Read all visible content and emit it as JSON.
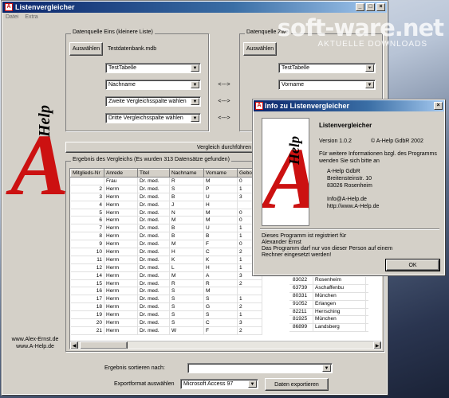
{
  "main_window": {
    "title": "Listenvergleicher",
    "menu": [
      "Datei",
      "Extra"
    ],
    "group1": {
      "label": "Datenquelle Eins (kleinere Liste)",
      "choose_button": "Auswählen",
      "file_value": "Testdatenbank.mdb",
      "table_value": "TestTabelle",
      "col1_value": "Nachname",
      "col2_value": "Zweite Vergleichsspalte wählen",
      "col3_value": "Dritte Vergleichsspalte wählen"
    },
    "arrows": [
      "<--->",
      "<--->",
      "<--->",
      "<--->"
    ],
    "group2": {
      "label": "Datenquelle Zwei",
      "choose_button": "Auswählen",
      "table_value": "TestTabelle",
      "col1_value": "Vorname"
    },
    "compare_button": "Vergleich durchführen",
    "results_label": "Ergebnis des Vergleichs (Es wurden 313 Datensätze gefunden)",
    "logo": {
      "letter": "A",
      "word": "Help"
    },
    "left_footer": [
      "www.Alex-Ernst.de",
      "www.A-Help.de"
    ],
    "sort_label": "Ergebnis sortieren nach:",
    "sort_value": "",
    "export_label": "Exportformat auswählen",
    "export_format": "Microsoft Access 97",
    "export_button": "Daten exportieren"
  },
  "table": {
    "columns": [
      "Mitglieds-Nr",
      "Anrede",
      "Titel",
      "Nachname",
      "Vorname",
      "Gebor"
    ],
    "rows": [
      [
        "",
        "Frau",
        "Dr. med.",
        "R",
        "M",
        "0"
      ],
      [
        "2",
        "Herrn",
        "Dr. med.",
        "S",
        "P",
        "1"
      ],
      [
        "3",
        "Herrn",
        "Dr. med.",
        "B",
        "U",
        "3"
      ],
      [
        "4",
        "Herrn",
        "Dr. med.",
        "J",
        "H",
        ""
      ],
      [
        "5",
        "Herrn",
        "Dr. med.",
        "N",
        "M",
        "0"
      ],
      [
        "6",
        "Herrn",
        "Dr. med.",
        "M",
        "M",
        "0"
      ],
      [
        "7",
        "Herrn",
        "Dr. med.",
        "B",
        "U",
        "1"
      ],
      [
        "8",
        "Herrn",
        "Dr. med.",
        "B",
        "B",
        "1"
      ],
      [
        "9",
        "Herrn",
        "Dr. med.",
        "M",
        "F",
        "0"
      ],
      [
        "10",
        "Herrn",
        "Dr. med.",
        "H",
        "C",
        "2"
      ],
      [
        "11",
        "Herrn",
        "Dr. med.",
        "K",
        "K",
        "1"
      ],
      [
        "12",
        "Herrn",
        "Dr. med.",
        "L",
        "H",
        "1"
      ],
      [
        "14",
        "Herrn",
        "Dr. med.",
        "M",
        "A",
        "3"
      ],
      [
        "15",
        "Herrn",
        "Dr. med.",
        "R",
        "R",
        "2"
      ],
      [
        "16",
        "Herrn",
        "Dr. med.",
        "S",
        "M",
        ""
      ],
      [
        "17",
        "Herrn",
        "Dr. med.",
        "S",
        "S",
        "1"
      ],
      [
        "18",
        "Herrn",
        "Dr. med.",
        "S",
        "G",
        "2"
      ],
      [
        "19",
        "Herrn",
        "Dr. med.",
        "S",
        "S",
        "1"
      ],
      [
        "20",
        "Herrn",
        "Dr. med.",
        "S",
        "C",
        "3"
      ],
      [
        "21",
        "Herrn",
        "Dr. med.",
        "W",
        "F",
        "2"
      ]
    ],
    "overflow_rows": [
      [
        "83022",
        "Rosenheim"
      ],
      [
        "63739",
        "Aschaffenbu"
      ],
      [
        "80331",
        "München"
      ],
      [
        "91052",
        "Erlangen"
      ],
      [
        "82211",
        "Herrsching"
      ],
      [
        "81925",
        "München"
      ],
      [
        "86899",
        "Landsberg"
      ]
    ]
  },
  "dialog": {
    "title": "Info zu Listenvergleicher",
    "app_name": "Listenvergleicher",
    "version": "Version 1.0.2",
    "copyright": "© A-Help GdbR 2002",
    "info_text": "Für weitere Informationen bzgl. des Programms wenden Sie sich bitte an",
    "company": "A-Help GdbR",
    "street": "Breitensteinstr. 10",
    "city": "83026 Rosenheim",
    "email": "Info@A-Help.de",
    "web": "http://www.A-Help.de",
    "registered": "Dieses Programm ist registriert für",
    "registered_name": "Alexander Ernst",
    "warning": "Das Programm darf nur von dieser Person auf einem Rechner eingesetzt werden!",
    "ok_button": "OK"
  },
  "watermark": {
    "brand": "soft-ware.net",
    "tagline": "AKTUELLE DOWNLOADS"
  },
  "colors": {
    "titlebar": "#0a246a",
    "logo_red": "#cc1111",
    "face": "#d4d0c8"
  }
}
